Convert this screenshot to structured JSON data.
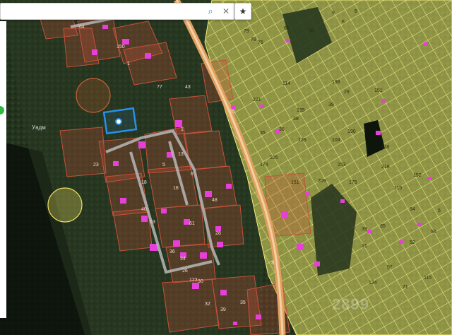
{
  "search": {
    "value": "",
    "placeholder": ""
  },
  "map_labels": {
    "place": "Уадм",
    "road_marker": "3"
  },
  "plot_numbers": {
    "yellow": [
      "79",
      "61",
      "76",
      "78",
      "50",
      "9",
      "6",
      "8",
      "198",
      "29",
      "221",
      "114",
      "39",
      "135",
      "151",
      "104",
      "190",
      "135",
      "35",
      "36",
      "38",
      "225",
      "118",
      "174",
      "153",
      "175",
      "181",
      "209",
      "218",
      "152",
      "115",
      "54",
      "39",
      "35",
      "31",
      "52",
      "56",
      "124",
      "57",
      "71",
      "115",
      "5"
    ],
    "red": [
      "64",
      "150",
      "1",
      "43",
      "77",
      "1",
      "23",
      "5",
      "13",
      "6",
      "18",
      "18",
      "40",
      "48",
      "63",
      "61",
      "28",
      "36",
      "34",
      "26",
      "30",
      "32",
      "39",
      "35",
      "65",
      "123"
    ]
  },
  "watermark": "2899",
  "colors": {
    "cadastral_yellow": "#e8e468",
    "parcel_red": "#c8503a",
    "parcel_magenta": "#e640d8",
    "road": "#e0a060",
    "selection": "#2a8ee8",
    "zone_outline": "#f0e060"
  },
  "icons": [
    "search-icon",
    "close-icon",
    "star-icon"
  ]
}
